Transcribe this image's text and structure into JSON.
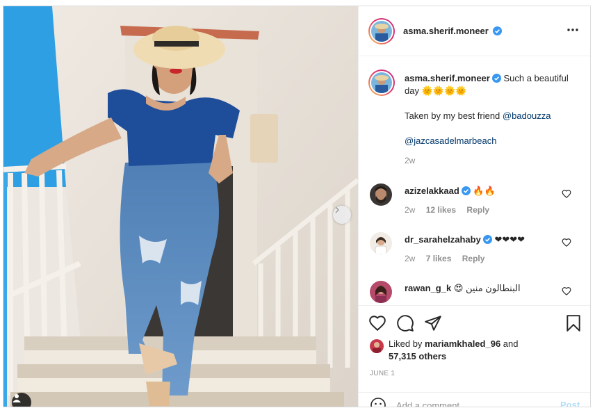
{
  "post": {
    "author": "asma.sherif.moneer",
    "caption": "Such a beautiful day 🌞🌞🌞🌞",
    "caption_line2_prefix": "Taken by my best friend",
    "mention_1": "@badouzza",
    "mention_2": "@jazcasadelmarbeach",
    "caption_age": "2w",
    "date": "JUNE 1"
  },
  "comments": [
    {
      "username": "azizelakkaad",
      "text": "🔥🔥",
      "age": "2w",
      "likes": "12 likes",
      "reply": "Reply",
      "verified": true
    },
    {
      "username": "dr_sarahelzahaby",
      "text": "❤❤❤❤",
      "age": "2w",
      "likes": "7 likes",
      "reply": "Reply",
      "verified": true
    },
    {
      "username": "rawan_g_k",
      "text": "البنطالون منين 😍",
      "verified": false
    }
  ],
  "likes": {
    "prefix": "Liked by",
    "user": "mariamkhaled_96",
    "and": "and",
    "count": "57,315 others"
  },
  "comment_box": {
    "placeholder": "Add a comment...",
    "post_label": "Post"
  },
  "icons": {
    "more": "more-horizontal-icon",
    "verified": "verified-badge-icon",
    "like": "heart-icon",
    "comment": "comment-icon",
    "share": "paper-plane-icon",
    "save": "bookmark-icon",
    "emoji": "smiley-icon",
    "next": "chevron-right-icon",
    "tag": "user-tag-icon"
  },
  "colors": {
    "verified": "#3897f0",
    "mention": "#00376b",
    "post_button": "#b2dffc",
    "story_ring": "#e1306c"
  }
}
